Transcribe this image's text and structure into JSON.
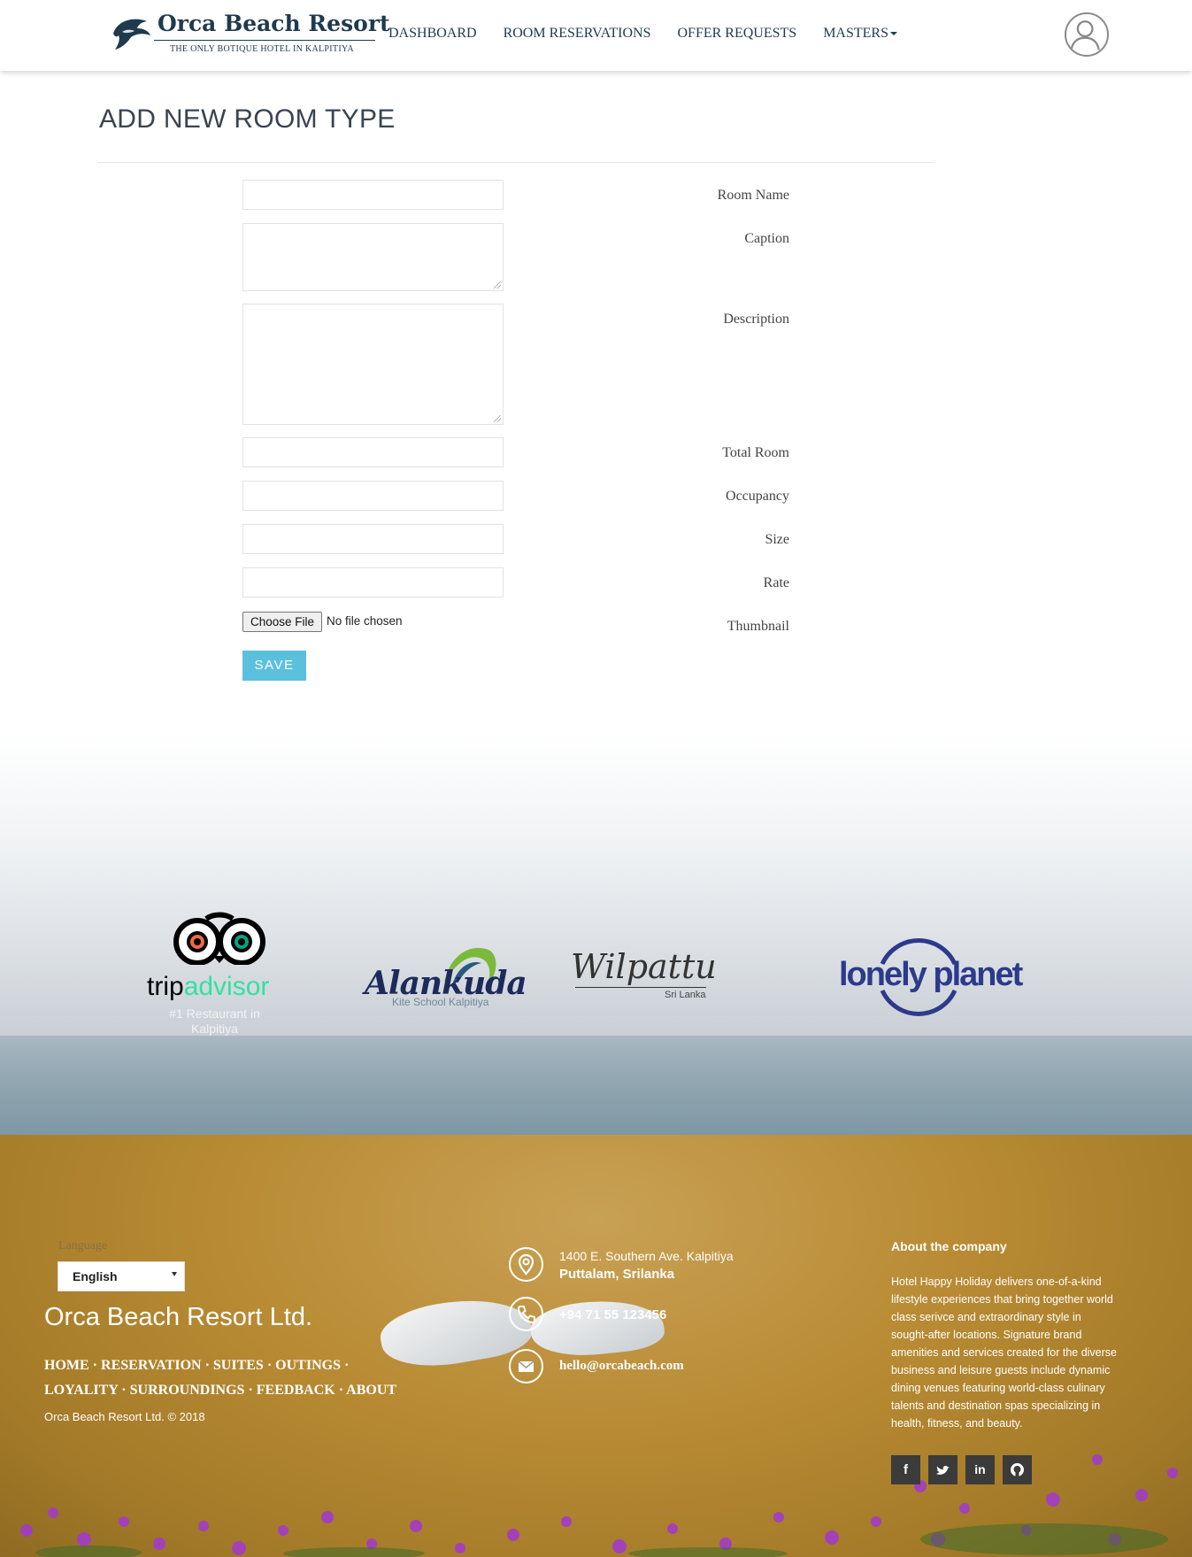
{
  "brand": {
    "name": "Orca Beach Resort",
    "tagline": "THE ONLY BOTIQUE HOTEL IN KALPITIYA"
  },
  "nav": {
    "dashboard": "DASHBOARD",
    "room_reservations": "ROOM RESERVATIONS",
    "offer_requests": "OFFER REQUESTS",
    "masters": "MASTERS"
  },
  "page": {
    "title": "ADD NEW ROOM TYPE"
  },
  "form": {
    "room_name": {
      "label": "Room Name",
      "value": ""
    },
    "caption": {
      "label": "Caption",
      "value": ""
    },
    "description": {
      "label": "Description",
      "value": ""
    },
    "total_room": {
      "label": "Total Room",
      "value": ""
    },
    "occupancy": {
      "label": "Occupancy",
      "value": ""
    },
    "size": {
      "label": "Size",
      "value": ""
    },
    "rate": {
      "label": "Rate",
      "value": ""
    },
    "thumbnail": {
      "label": "Thumbnail",
      "button": "Choose File",
      "status": "No file chosen"
    },
    "save_label": "SAVE"
  },
  "partners": {
    "tripadvisor_trip": "trip",
    "tripadvisor_advisor": "advisor",
    "tripadvisor_sub": "#1 Restaurant in Kalpitiya",
    "alankuda": "Alankuda",
    "alankuda_sub": "Kite School Kalpitiya",
    "wilpattu": "Wilpattu",
    "wilpattu_sub": "Sri Lanka",
    "lonely_planet": "lonely planet"
  },
  "footer": {
    "language_label": "Language",
    "language_value": "English",
    "company": "Orca Beach Resort Ltd.",
    "links": [
      "HOME",
      "RESERVATION",
      "SUITES",
      "OUTINGS",
      "LOYALITY",
      "SURROUNDINGS",
      "FEEDBACK",
      "ABOUT"
    ],
    "copyright": "Orca Beach Resort Ltd. © 2018",
    "address_line1": "1400 E. Southern Ave. Kalpitiya",
    "address_line2": "Puttalam, Srilanka",
    "phone": "+94 71 55 123456",
    "email": "hello@orcabeach.com",
    "about_title": "About the company",
    "about_text": "Hotel Happy Holiday delivers one-of-a-kind lifestyle experiences that bring together world class serivce and extraordinary style in sought-after locations. Signature brand amenities and services created for the diverse business and leisure guests include dynamic dining venues featuring world-class culinary talents and destination spas specializing in health, fitness, and beauty."
  },
  "colors": {
    "brand_navy": "#1f3a4d",
    "save_button": "#5bc0de",
    "lonely_planet": "#2d3a8c",
    "tripadvisor_green": "#34e0a1"
  },
  "icons": {
    "social": [
      "facebook-icon",
      "twitter-icon",
      "linkedin-icon",
      "github-icon"
    ],
    "contact": [
      "map-pin-icon",
      "phone-icon",
      "envelope-icon"
    ]
  }
}
